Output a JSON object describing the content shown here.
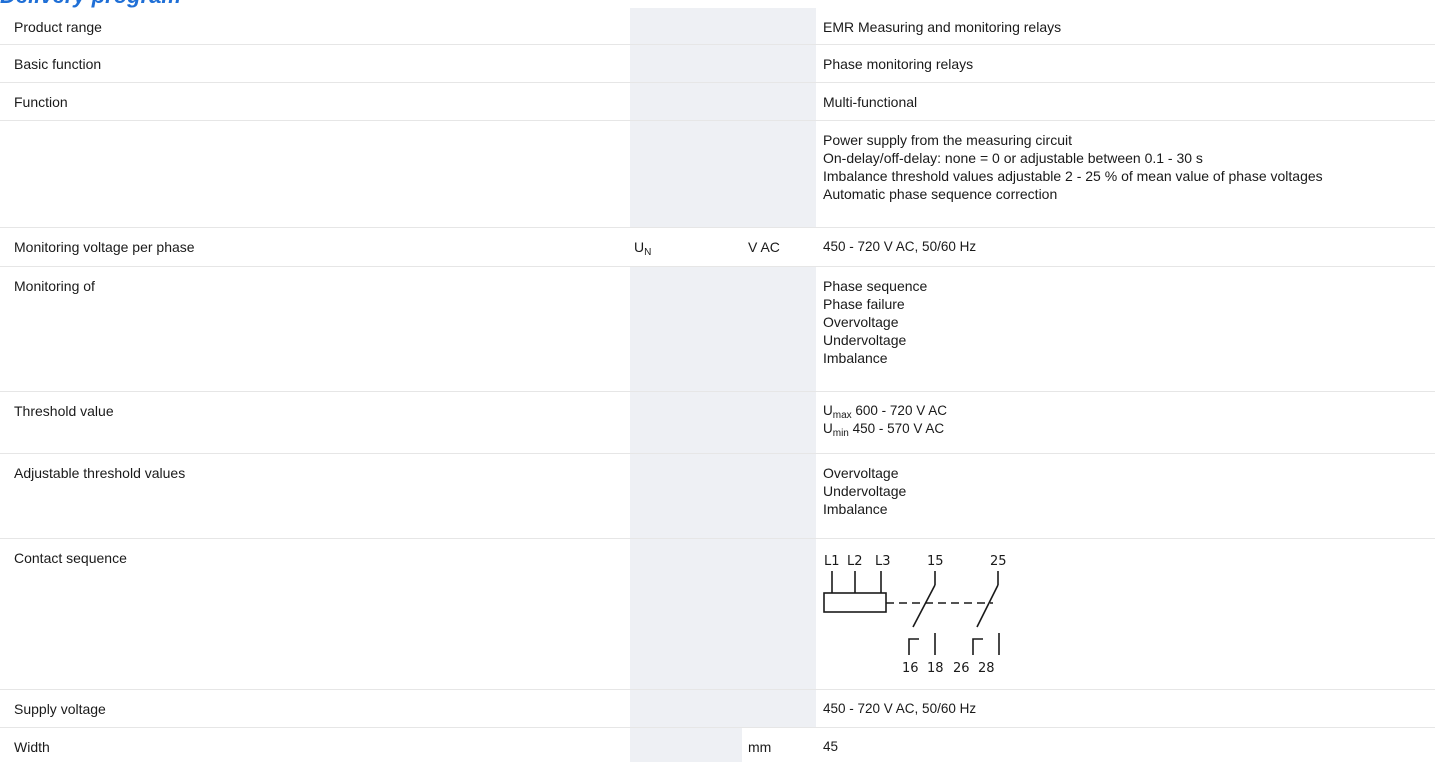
{
  "heading": "Delivery program",
  "rows": [
    {
      "label": "Product range",
      "symbol": "",
      "unit": "",
      "value_lines": [
        "EMR Measuring and monitoring relays"
      ]
    },
    {
      "label": "Basic function",
      "symbol": "",
      "unit": "",
      "value_lines": [
        "Phase monitoring relays"
      ]
    },
    {
      "label": "Function",
      "symbol": "",
      "unit": "",
      "value_lines": [
        "Multi-functional"
      ]
    },
    {
      "label": "",
      "symbol": "",
      "unit": "",
      "value_lines": [
        "Power supply from the measuring circuit",
        "On-delay/off-delay: none = 0 or adjustable between 0.1 - 30 s",
        "Imbalance threshold values adjustable 2 - 25 % of mean value of phase voltages",
        "Automatic phase sequence correction"
      ]
    },
    {
      "label": "Monitoring voltage per phase",
      "symbol": "U",
      "symbol_sub": "N",
      "unit": "V AC",
      "value_lines": [
        "450 - 720 V AC, 50/60 Hz"
      ]
    },
    {
      "label": "Monitoring of",
      "symbol": "",
      "unit": "",
      "value_lines": [
        "Phase sequence",
        "Phase failure",
        "Overvoltage",
        "Undervoltage",
        "Imbalance"
      ]
    },
    {
      "label": "Threshold value",
      "symbol": "",
      "unit": "",
      "threshold_lines": [
        {
          "sym": "U",
          "sub": "max",
          "text": " 600 - 720 V AC"
        },
        {
          "sym": "U",
          "sub": "min",
          "text": " 450 - 570 V AC"
        }
      ]
    },
    {
      "label": "Adjustable threshold values",
      "symbol": "",
      "unit": "",
      "value_lines": [
        "Overvoltage",
        "Undervoltage",
        "Imbalance"
      ]
    },
    {
      "label": "Contact sequence",
      "symbol": "",
      "unit": "",
      "diagram_labels": {
        "top": [
          "L1",
          "L2",
          "L3",
          "15",
          "25"
        ],
        "bottom": [
          "16",
          "18",
          "26",
          "28"
        ]
      }
    },
    {
      "label": "Supply voltage",
      "symbol": "",
      "unit": "",
      "value_lines": [
        "450 - 720 V AC, 50/60 Hz"
      ]
    },
    {
      "label": "Width",
      "symbol": "",
      "unit": "mm",
      "value_lines": [
        "45"
      ]
    }
  ]
}
